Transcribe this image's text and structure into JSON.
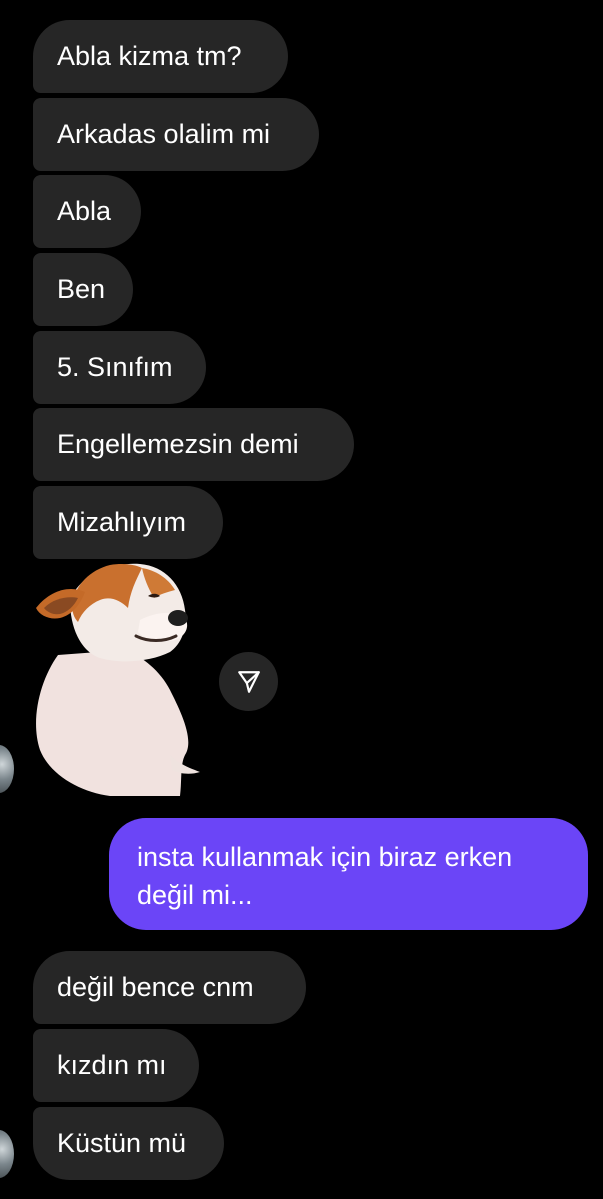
{
  "messages": {
    "received_group_1": [
      "Abla kizma tm?",
      "Arkadas olalim mi",
      "Abla",
      "Ben",
      "5. Sınıfım",
      "Engellemezsin demi",
      "Mizahlıyım"
    ],
    "sticker": {
      "icon": "smirking-corgi-sticker"
    },
    "sent": [
      "insta kullanmak için biraz erken değil mi..."
    ],
    "received_group_2": [
      "değil bence cnm",
      "kızdın mı",
      "Küstün mü"
    ]
  },
  "icons": {
    "share": "send-arrow-icon",
    "avatar": "contact-avatar"
  },
  "colors": {
    "background": "#000000",
    "received_bubble": "#262626",
    "sent_bubble": "#6b45f7",
    "text": "#ffffff"
  }
}
